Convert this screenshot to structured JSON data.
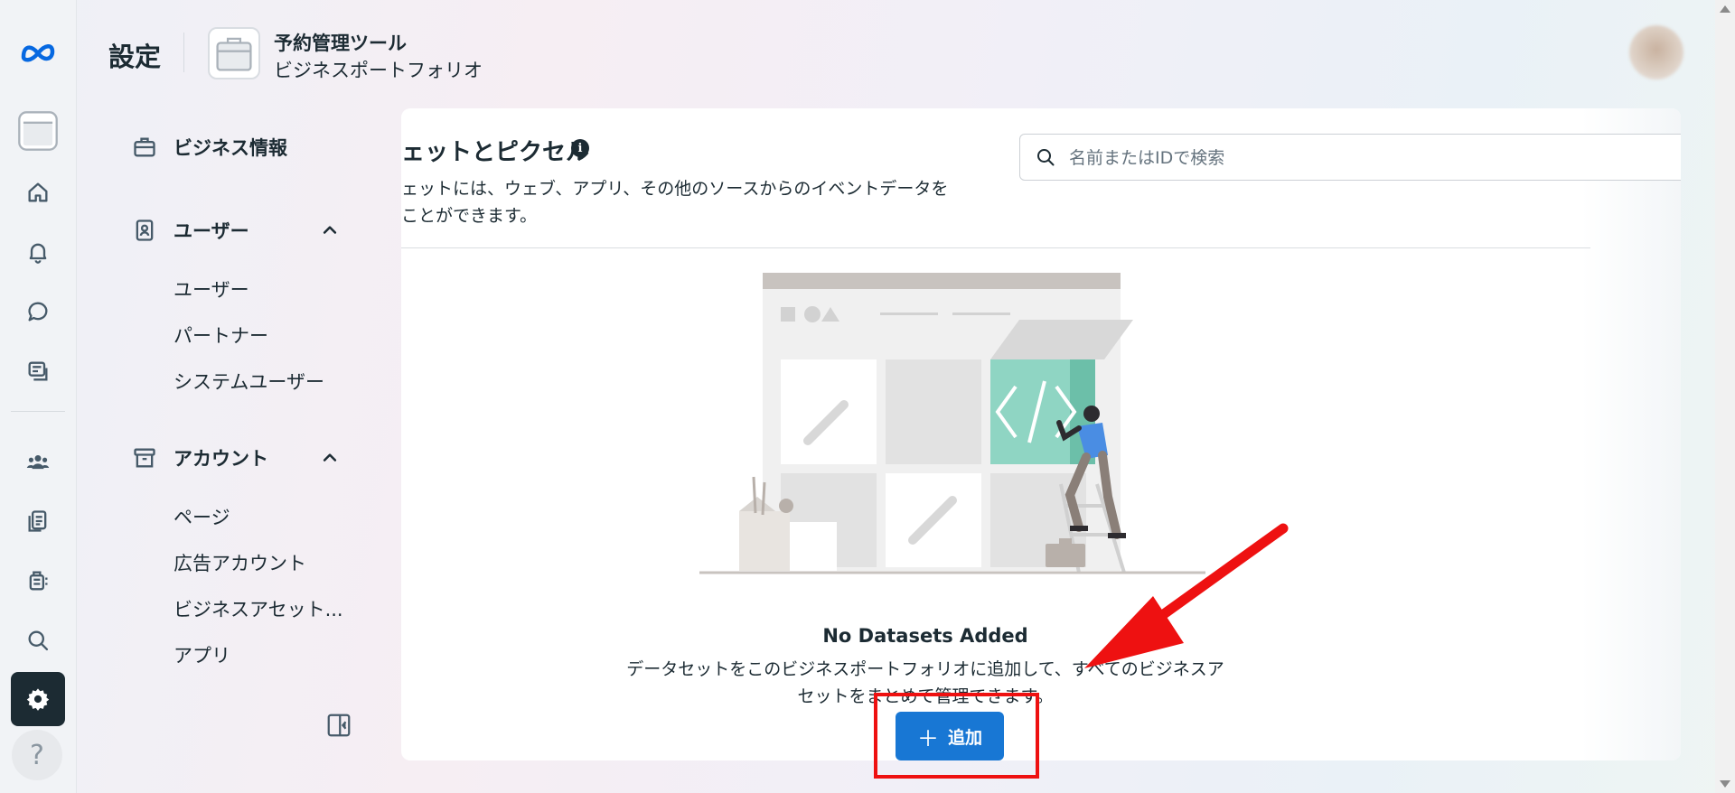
{
  "header": {
    "title": "設定",
    "business_name": "予約管理ツール",
    "business_subtitle": "ビジネスポートフォリオ"
  },
  "sidebar": {
    "business_info": "ビジネス情報",
    "users_section": "ユーザー",
    "users_items": [
      "ユーザー",
      "パートナー",
      "システムユーザー"
    ],
    "accounts_section": "アカウント",
    "accounts_items": [
      "ページ",
      "広告アカウント",
      "ビジネスアセット...",
      "アプリ"
    ]
  },
  "rail": {
    "icons": [
      "meta-logo-icon",
      "business-portfolio-icon",
      "home-icon",
      "bell-icon",
      "chat-icon",
      "inbox-icon",
      "people-icon",
      "pages-icon",
      "ads-icon",
      "search-icon",
      "settings-icon",
      "help-icon"
    ],
    "help_label": "?"
  },
  "main": {
    "title": "ェットとピクセル",
    "description_line1": "ェットには、ウェブ、アプリ、その他のソースからのイベントデータを",
    "description_line2": "ことができます。",
    "search_placeholder": "名前またはIDで検索",
    "empty_title": "No Datasets Added",
    "empty_desc_line1": "データセットをこのビジネスポートフォリオに追加して、すべてのビジネスア",
    "empty_desc_line2": "セットをまとめて管理できます。",
    "add_button_label": "追加"
  },
  "annotation_colors": {
    "highlight": "#ee1111",
    "accent": "#1877d4"
  }
}
